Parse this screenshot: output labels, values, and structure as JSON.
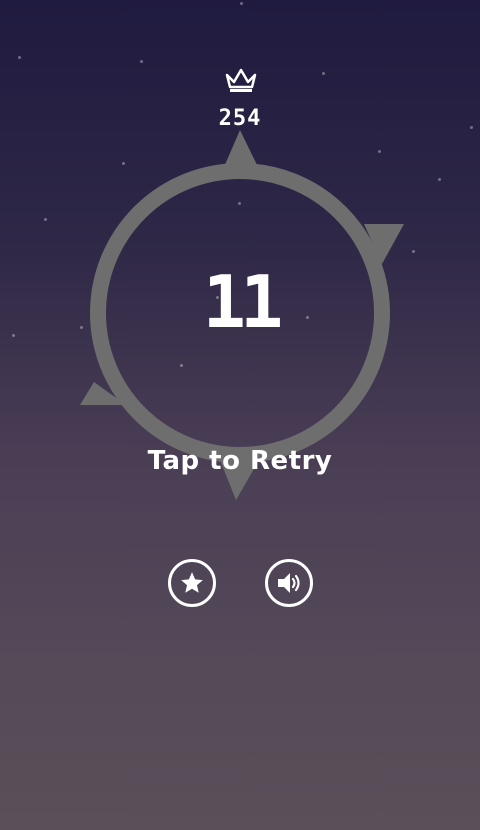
{
  "hud": {
    "best_score": "254",
    "best_icon": "crown-icon"
  },
  "game": {
    "score": "11",
    "retry_label": "Tap to Retry"
  },
  "buttons": {
    "rate_icon": "star-icon",
    "sound_icon": "speaker-icon"
  },
  "colors": {
    "background_top": "#1f1a3f",
    "background_bottom": "#5a5059",
    "ring": "#6e6e6e",
    "text": "#ffffff"
  }
}
